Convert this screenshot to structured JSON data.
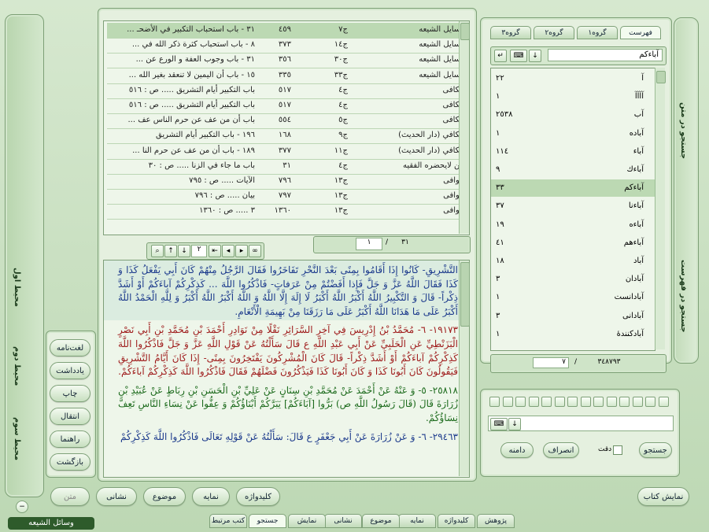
{
  "refs": [
    {
      "book": "وسايل الشيعه",
      "vol": "ج٧",
      "page": "٤٥٩",
      "title": "٣١ - باب استحباب التكبير في الأضحـ ..."
    },
    {
      "book": "وسايل الشيعه",
      "vol": "ج١٤",
      "page": "٣٧٣",
      "title": "٨ - باب استحباب كثرة ذكر الله في ..."
    },
    {
      "book": "وسايل الشيعه",
      "vol": "ج٣٠",
      "page": "٣٥٦",
      "title": "٣١ - باب وجوب العفة و الورع عن ..."
    },
    {
      "book": "وسايل الشيعه",
      "vol": "ج٣٣",
      "page": "٣٣٥",
      "title": "١٥ - باب أن اليمين لا تنعقد بغير الله ..."
    },
    {
      "book": "الكافى",
      "vol": "ج٤",
      "page": "٥١٧",
      "title": "باب التكبير أيام التشريق ..... ص : ٥١٦"
    },
    {
      "book": "الكافى",
      "vol": "ج٤",
      "page": "٥١٧",
      "title": "باب التكبير أيام التشريق ..... ص : ٥١٦"
    },
    {
      "book": "الكافى",
      "vol": "ج٥",
      "page": "٥٥٤",
      "title": "باب أن من عف عن حرم الناس عف ..."
    },
    {
      "book": "الكافي (دار الحديث)",
      "vol": "ج٩",
      "page": "١٦٨",
      "title": "١٩٦ - باب التكبير أيام التشريق"
    },
    {
      "book": "الكافي (دار الحديث)",
      "vol": "ج١١",
      "page": "٣٧٧",
      "title": "١٨٩ - باب أن من عف عن حرم النا ..."
    },
    {
      "book": "من لايحضره الفقيه",
      "vol": "ج٤",
      "page": "٣١",
      "title": "باب ما جاء في الزنا ..... ص : ٣٠"
    },
    {
      "book": "الوافى",
      "vol": "ج١٣",
      "page": "٧٩٦",
      "title": "الآيات ..... ص : ٧٩٥"
    },
    {
      "book": "الوافى",
      "vol": "ج١٣",
      "page": "٧٩٧",
      "title": "بيان ..... ص : ٧٩٦"
    },
    {
      "book": "الوافى",
      "vol": "ج١٣",
      "page": "١٣٦٠",
      "title": "٣ ..... ص : ١٣٦٠"
    }
  ],
  "ref_pager": {
    "current": "١",
    "total": "٣١"
  },
  "text_nav": {
    "page": "٢"
  },
  "paragraphs": [
    {
      "cls": "blue",
      "text": "التَّشْرِيقِ- كَانُوا إِذَا أَقَامُوا بِمِنًى بَعْدَ النَّحْرِ تَفَاخَرُوا فَقَالَ الرَّجُلُ مِنْهُمْ كَانَ أَبِي يَفْعَلُ كَذَا وَ كَذَا فَقَالَ اللَّهُ عَزَّ وَ جَلَّ فَإِذا أَفَضْتُمْ مِنْ عَرَفاتٍ- فَاذْكُرُوا اللَّهَ ... كَذِكْرِكُمْ آباءَكُمْ أَوْ أَشَدَّ ذِكْراً- قَالَ وَ التَّكْبِيرُ اللَّهُ أَكْبَرُ اللَّهُ أَكْبَرُ لَا إِلَهَ إِلَّا اللَّهُ وَ اللَّهُ أَكْبَرُ اللَّهُ أَكْبَرُ وَ لِلَّهِ الْحَمْدُ اللَّهُ أَكْبَرُ عَلَى مَا هَدَانَا اللَّهُ أَكْبَرُ عَلَى مَا رَزَقَنَا مِنْ بَهِيمَةِ الْأَنْعَامِ."
    },
    {
      "cls": "red",
      "text": "١٩١٧٣- ٦- مُحَمَّدُ بْنُ إِدْرِيسَ فِي آخِرِ السَّرَائِرِ نَقْلًا مِنْ نَوَادِرِ أَحْمَدَ بْنِ مُحَمَّدِ بْنِ أَبِي نَصْرٍ الْبَزَنْطِيِّ عَنِ الْحَلَبِيِّ عَنْ أَبِي عَبْدِ اللَّهِ ع قَالَ سَأَلْتُهُ عَنْ قَوْلِ اللَّهِ عَزَّ وَ جَلَّ فَاذْكُرُوا اللَّهَ كَذِكْرِكُمْ آباءَكُمْ أَوْ أَشَدَّ ذِكْراً- قَالَ كَانَ الْمُشْرِكُونَ يَفْتَخِرُونَ بِمِنًى- إِذَا كَانَ أَيَّامُ التَّشْرِيقِ فَيَقُولُونَ كَانَ أَبُونَا كَذَا وَ كَانَ أَبُونَا كَذَا فَيَذْكُرُونَ فَضْلَهُمْ فَقَالَ فَاذْكُرُوا اللَّهَ كَذِكْرِكُمْ آباءَكُمْ."
    },
    {
      "cls": "green",
      "text": "٢٥٨١٨- ٥- وَ عَنْهُ عَنْ أَحْمَدَ عَنْ مُحَمَّدِ بْنِ سِنَانٍ عَنْ عَلِيِّ بْنِ الْحَسَنِ بْنِ رِبَاطٍ عَنْ عُبَيْدِ بْنِ زُرَارَةَ قَالَ (قَالَ رَسُولُ اللَّهِ ص) بَرُّوا [آبَاءَكُمْ] يَبَرَّكُمْ أَبْنَاؤُكُمْ وَ عِفُّوا عَنْ نِسَاءِ النَّاسِ تَعِفَّ نِسَاؤُكُمْ."
    },
    {
      "cls": "blue",
      "text": "٢٩٤٦٣- ٦- وَ عَنْ زُرَارَةَ عَنْ أَبِي جَعْفَرٍ ع قَالَ: سَأَلْتُهُ عَنْ قَوْلِهِ تَعَالَى فَاذْكُرُوا اللَّهَ كَذِكْرِكُمْ"
    }
  ],
  "right_tabs": [
    "فهرست",
    "گروه١",
    "گروه٢",
    "گروه٣"
  ],
  "search_value": "آباءکم",
  "words": [
    {
      "w": "آ",
      "c": "٢٢"
    },
    {
      "w": "آآآآ",
      "c": "١"
    },
    {
      "w": "آب",
      "c": "٢٥٣٨"
    },
    {
      "w": "آباده",
      "c": "١"
    },
    {
      "w": "آباء",
      "c": "١١٤"
    },
    {
      "w": "آباءك",
      "c": "٩"
    },
    {
      "w": "آباءکم",
      "c": "٣٣"
    },
    {
      "w": "آباءنا",
      "c": "٣٧"
    },
    {
      "w": "آباءه",
      "c": "١٩"
    },
    {
      "w": "آباءهم",
      "c": "٤١"
    },
    {
      "w": "آباد",
      "c": "١٨"
    },
    {
      "w": "آبادان",
      "c": "٣"
    },
    {
      "w": "آبادانست",
      "c": "١"
    },
    {
      "w": "آبادانی",
      "c": "٣"
    },
    {
      "w": "آبادکنندهٔ",
      "c": "١"
    }
  ],
  "word_pager": {
    "current": "٧",
    "total": "٣٤٨٧٩٣"
  },
  "side_vtabs": {
    "search_text": "جستجو در متن",
    "search_index": "جستجو در فهرست"
  },
  "left_vtabs": [
    "محیط اول",
    "محیط دوم",
    "محیط سوم"
  ],
  "left_buttons": [
    "لغت‌نامه",
    "یادداشت",
    "چاپ",
    "انتقال",
    "راهنما",
    "بازگشت"
  ],
  "search_controls": {
    "search": "جستجو",
    "exact": "دقت",
    "cancel": "انصراف",
    "more": "دامنه"
  },
  "bottom_buttons": {
    "show_book": "نمایش کتاب",
    "marks": "نشانی",
    "subject": "موضوع",
    "index": "نمایه",
    "keyword": "کلیدواژه",
    "text": "متن"
  },
  "bottom_tabs": [
    "پژوهش",
    "کلیدواژه",
    "نمایه",
    "موضوع",
    "نشانی",
    "نمایش",
    "جستجو",
    "کتب مرتبط"
  ],
  "status_title": "وسائل الشيعه"
}
